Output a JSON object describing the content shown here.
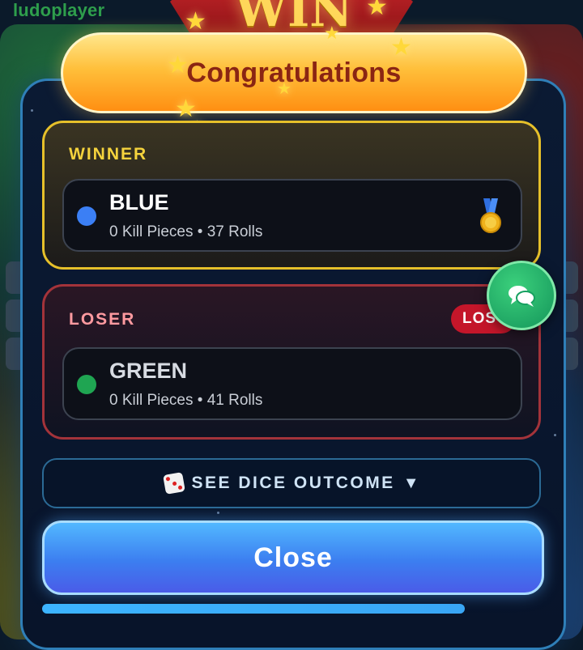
{
  "app": {
    "logo_text": "ludoplayer"
  },
  "modal": {
    "ribbon_text": "WIN",
    "title": "Congratulations"
  },
  "winner": {
    "section_label": "WINNER",
    "player_name": "BLUE",
    "player_color": "#3b7ff5",
    "stats": "0 Kill Pieces • 37 Rolls",
    "medal_icon": "medal-icon"
  },
  "loser": {
    "section_label": "LOSER",
    "badge": "LOST",
    "player_name": "GREEN",
    "player_color": "#1fa552",
    "stats": "0 Kill Pieces • 41 Rolls"
  },
  "dice_outcome": {
    "icon": "dice-icon",
    "label": "SEE DICE OUTCOME",
    "caret": "▼"
  },
  "close_button": {
    "label": "Close"
  },
  "chat_button": {
    "icon": "chat-bubbles-icon"
  },
  "progress": {
    "value": 0.85
  },
  "colors": {
    "winner_border": "#e6c02a",
    "loser_border": "#a3333a",
    "close_gradient_top": "#52b8ff",
    "chat_green": "#14955a"
  }
}
